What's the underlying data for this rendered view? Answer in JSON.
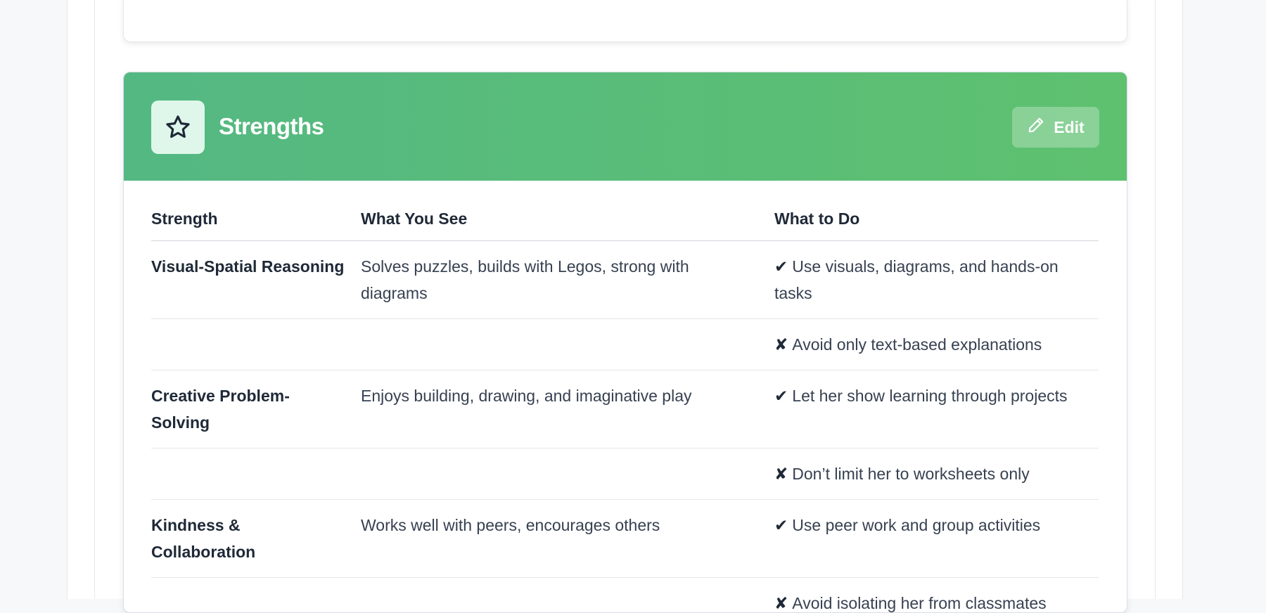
{
  "section": {
    "title": "Strengths",
    "edit_label": "Edit",
    "icon": "star-icon"
  },
  "table": {
    "headers": [
      "Strength",
      "What You See",
      "What to Do"
    ],
    "rows": [
      {
        "strength": "Visual-Spatial Reasoning",
        "see": "Solves puzzles, builds with Legos, strong with diagrams",
        "mark": "✔",
        "todo": "Use visuals, diagrams, and hands-on tasks"
      },
      {
        "strength": "",
        "see": "",
        "mark": "✘",
        "todo": "Avoid only text-based explanations"
      },
      {
        "strength": "Creative Problem-Solving",
        "see": "Enjoys building, drawing, and imaginative play",
        "mark": "✔",
        "todo": "Let her show learning through projects"
      },
      {
        "strength": "",
        "see": "",
        "mark": "✘",
        "todo": "Don’t limit her to worksheets only"
      },
      {
        "strength": "Kindness & Collaboration",
        "see": "Works well with peers, encourages others",
        "mark": "✔",
        "todo": "Use peer work and group activities"
      },
      {
        "strength": "",
        "see": "",
        "mark": "✘",
        "todo": "Avoid isolating her from classmates"
      }
    ]
  },
  "colors": {
    "header_start": "#54b883",
    "header_end": "#5ec16f",
    "icon_bg": "#dff7ea"
  }
}
